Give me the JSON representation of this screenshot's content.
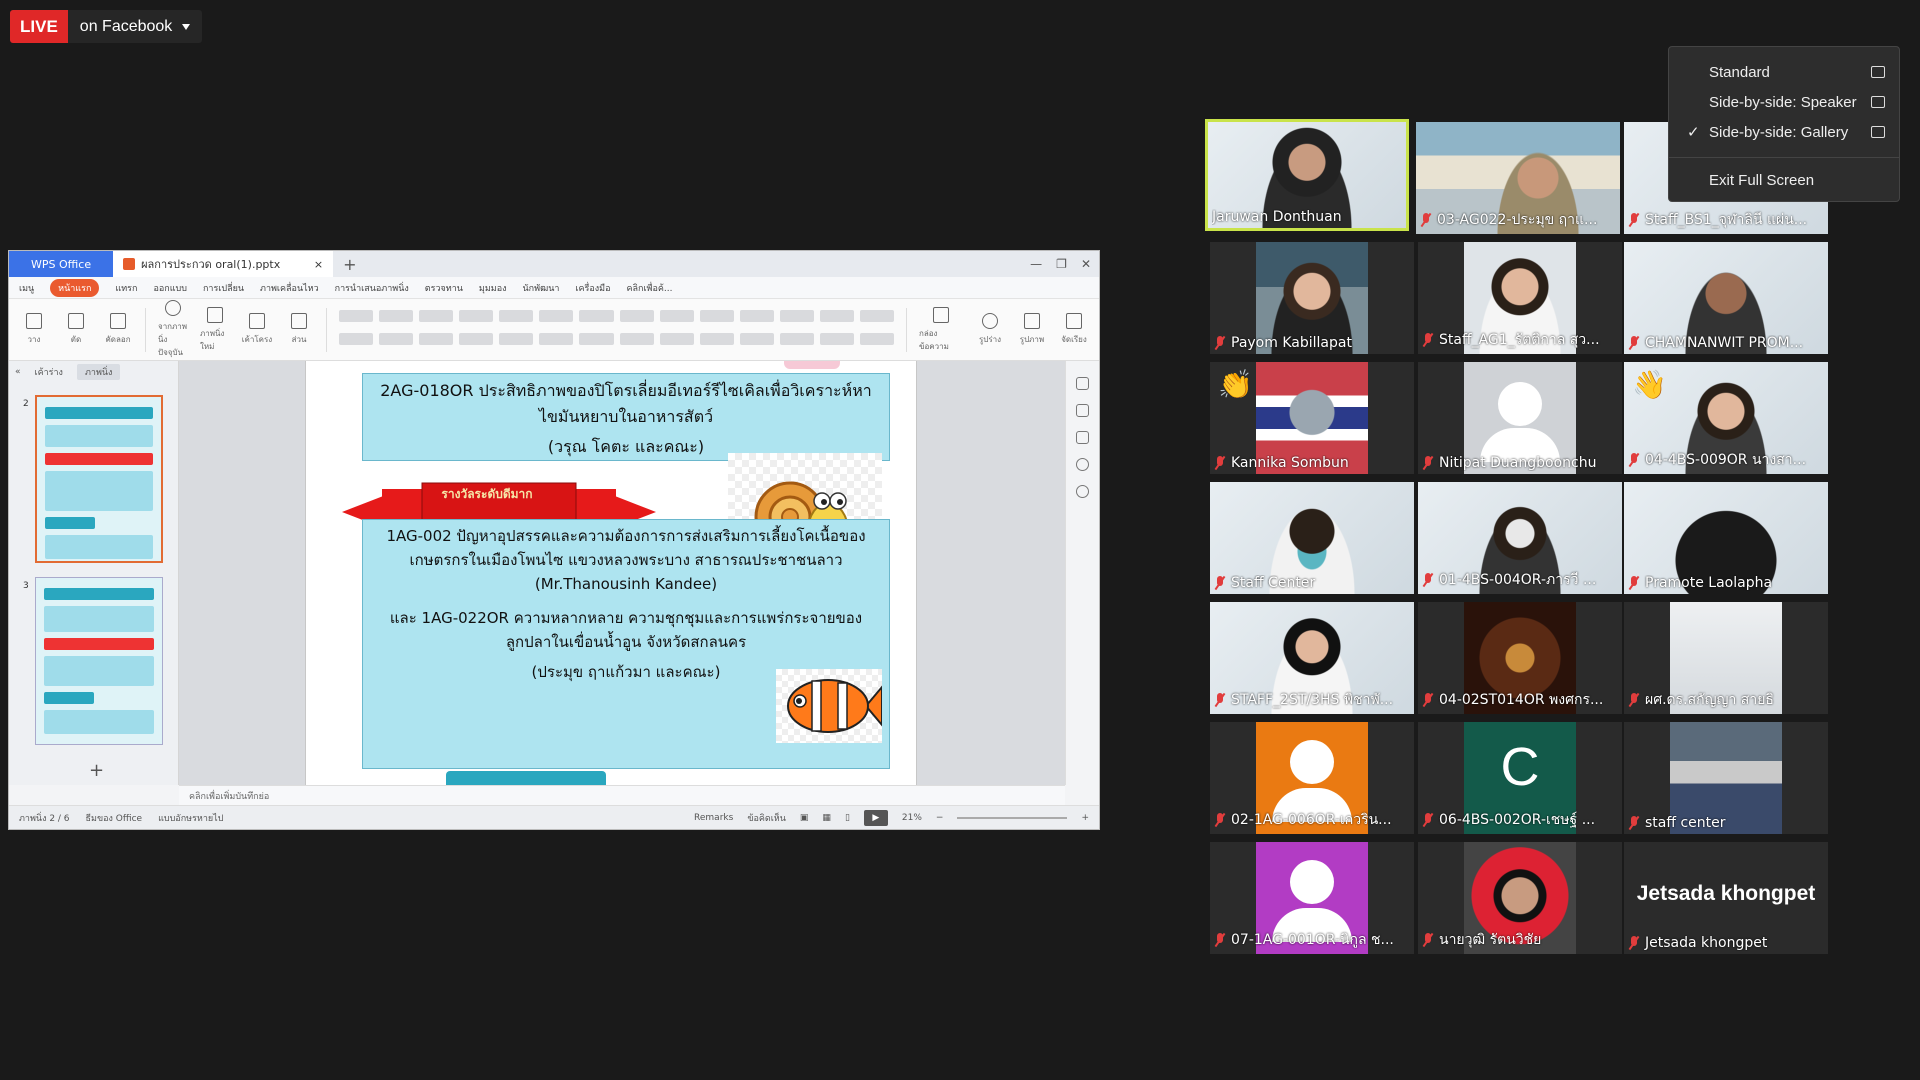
{
  "live": {
    "tag": "LIVE",
    "platform": "on Facebook"
  },
  "app": {
    "wps_tab": "WPS Office",
    "doc_tab": "ผลการประกวด oral(1).pptx",
    "menu": [
      "เมนู",
      "หน้าแรก",
      "แทรก",
      "ออกแบบ",
      "การเปลี่ยน",
      "ภาพเคลื่อนไหว",
      "การนำเสนอภาพนิ่ง",
      "ตรวจทาน",
      "มุมมอง",
      "นักพัฒนา",
      "เครื่องมือ",
      "คลิกเพื่อค้..."
    ],
    "ribbon": [
      "วาง",
      "ตัด",
      "คัดลอก",
      "จากภาพนิ่งปัจจุบัน",
      "ภาพนิ่งใหม่",
      "เค้าโครง",
      "ส่วน",
      "กล่องข้อความ",
      "รูปร่าง",
      "รูปภาพ",
      "จัดเรียง"
    ],
    "thumb_tabs": [
      "เค้าร่าง",
      "ภาพนิ่ง"
    ],
    "slide_numbers": [
      "2",
      "3"
    ],
    "notes": "คลิกเพื่อเพิ่มบันทึกย่อ",
    "status": {
      "slide": "ภาพนิ่ง 2 / 6",
      "theme": "ธีมของ Office",
      "font": "แบบอักษรหายไป",
      "remarks": "Remarks",
      "comment": "ข้อคิดเห็น",
      "zoom": "21%"
    },
    "slide": {
      "box1_title": "2AG-018OR ประสิทธิภาพของปิโตรเลี่ยมอีเทอร์รีไซเคิลเพื่อวิเคราะห์หาไขมันหยาบในอาหารสัตว์",
      "box1_author": "(วรุณ โคตะ และคณะ)",
      "banner": "รางวัลระดับดีมาก",
      "box2_title": "1AG-002 ปัญหาอุปสรรคและความต้องการการส่งเสริมการเลี้ยงโคเนื้อของเกษตรกรในเมืองโพนไซ แขวงหลวงพระบาง สาธารณประชาชนลาว",
      "box2_author": "(Mr.Thanousinh Kandee)",
      "box2_title2": "และ 1AG-022OR ความหลากหลาย ความชุกชุมและการแพร่กระจายของลูกปลาในเขื่อนน้ำอูน จังหวัดสกลนคร",
      "box2_author2": "(ประมุข ฤาแก้วมา และคณะ)"
    }
  },
  "view_menu": {
    "items": [
      "Standard",
      "Side-by-side: Speaker",
      "Side-by-side: Gallery",
      "Exit Full Screen"
    ],
    "checked_glyph": "✓"
  },
  "participants": [
    {
      "name": "Jaruwan Donthuan",
      "speaker": true,
      "muted": false
    },
    {
      "name": "03-AG022-ประมุข ฤาแ...",
      "muted": true
    },
    {
      "name": "Staff_BS1_จุฬาลินี แผ่น...",
      "muted": true
    },
    {
      "name": "Payom Kabillapat",
      "muted": true
    },
    {
      "name": "Staff_AG1_รัตติกาล สุว...",
      "muted": true
    },
    {
      "name": "CHAMNANWIT PROM...",
      "muted": true
    },
    {
      "name": "Kannika Sombun",
      "muted": true
    },
    {
      "name": "Nitipat Duangboonchu",
      "muted": true
    },
    {
      "name": "04-4BS-009OR นางสา...",
      "muted": true
    },
    {
      "name": "Staff Center",
      "muted": true
    },
    {
      "name": "01-4BS-004OR-ภารวี ...",
      "muted": true
    },
    {
      "name": "Pramote Laolapha",
      "muted": true
    },
    {
      "name": "STAFF_2ST/3HS พิชาพั...",
      "muted": true
    },
    {
      "name": "04-02ST014OR พงศกร...",
      "muted": true
    },
    {
      "name": "ผศ.ดร.สกัญญา สายธิ",
      "muted": true
    },
    {
      "name": "02-1AG-006OR-เกวริน...",
      "muted": true
    },
    {
      "name": "06-4BS-002OR-เชษฐ์ ...",
      "muted": true,
      "initial": "C"
    },
    {
      "name": "staff center",
      "muted": true
    },
    {
      "name": "07-1AG-001OR-นิกูล ช...",
      "muted": true
    },
    {
      "name": "นายวุฒิ รัตนวิชัย",
      "muted": true
    },
    {
      "name": "Jetsada khongpet",
      "muted": true,
      "display_text": "Jetsada khongpet"
    }
  ],
  "colors": {
    "live_red": "#e02828",
    "speaker_border": "#c9e34a",
    "mic_off": "#e13d3d",
    "wps_blue": "#3b72e7"
  }
}
